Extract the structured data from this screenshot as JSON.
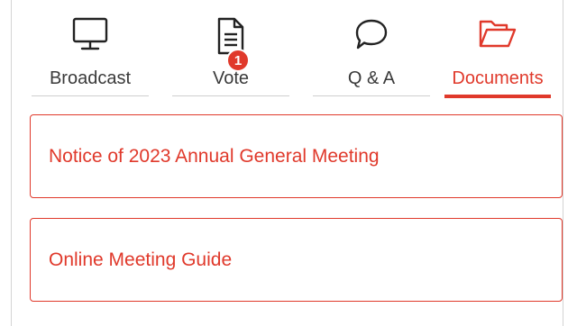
{
  "tabs": [
    {
      "label": "Broadcast",
      "icon": "monitor-icon",
      "active": false
    },
    {
      "label": "Vote",
      "icon": "document-icon",
      "active": false,
      "badge": "1"
    },
    {
      "label": "Q & A",
      "icon": "speech-bubble-icon",
      "active": false
    },
    {
      "label": "Documents",
      "icon": "folder-open-icon",
      "active": true
    }
  ],
  "documents": [
    {
      "title": "Notice of 2023 Annual General Meeting"
    },
    {
      "title": "Online Meeting Guide"
    }
  ],
  "colors": {
    "accent": "#e0392b",
    "text": "#3a3a3a",
    "border": "#d4d4d4"
  }
}
